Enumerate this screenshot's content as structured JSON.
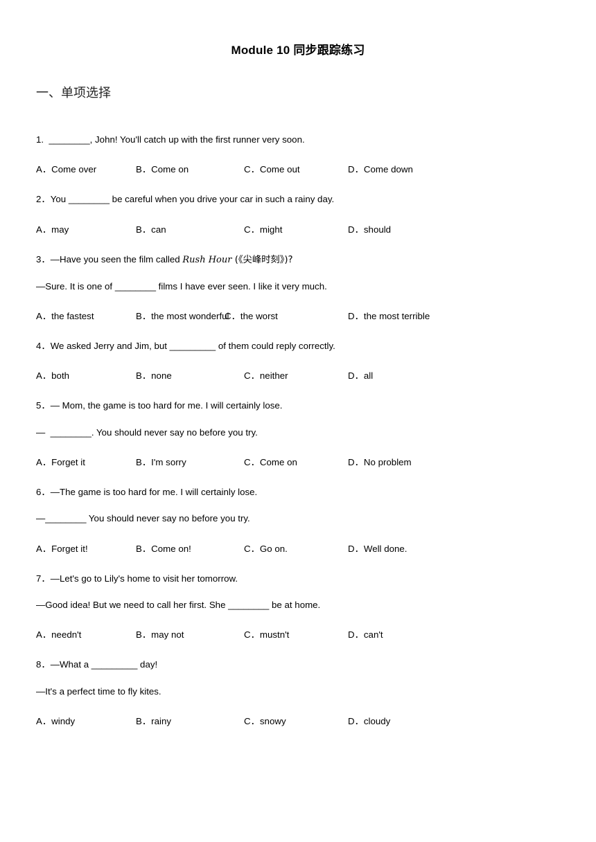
{
  "document": {
    "title": "Module 10 同步跟踪练习",
    "section_heading": "一、单项选择"
  },
  "questions": [
    {
      "lines": [
        "1.  ________, John! You'll catch up with the first runner very soon."
      ],
      "options": {
        "a": "A．Come over",
        "b": "B．Come on",
        "c": "C．Come out",
        "d": "D．Come down"
      }
    },
    {
      "lines": [
        "2．You ________ be careful when you drive your car in such a rainy day."
      ],
      "options": {
        "a": "A．may",
        "b": "B．can",
        "c": "C．might",
        "d": "D．should"
      }
    },
    {
      "lines_part1": "3．—Have you seen the film called ",
      "italic": "Rush Hour",
      "lines_part2": " (《尖峰时刻》)?",
      "line2": "—Sure. It is one of ________ films I have ever seen. I like it very much.",
      "options": {
        "a": "A．the fastest",
        "b": "B．the most wonderful",
        "c": "C．the worst",
        "d": "D．the most terrible"
      }
    },
    {
      "lines": [
        "4．We asked Jerry and Jim, but _________ of them could reply correctly."
      ],
      "options": {
        "a": "A．both",
        "b": "B．none",
        "c": "C．neither",
        "d": "D．all"
      }
    },
    {
      "line1": "5．— Mom, the game is too hard for me. I will certainly lose.",
      "line2": "—  ________. You should never say no before you try.",
      "options": {
        "a": "A．Forget it",
        "b": "B．I'm sorry",
        "c": "C．Come on",
        "d": "D．No problem"
      }
    },
    {
      "line1": "6．—The game is too hard for me. I will certainly lose.",
      "line2": "—________ You should never say no before you try.",
      "options": {
        "a": "A．Forget it!",
        "b": "B．Come on!",
        "c": "C．Go on.",
        "d": "D．Well done."
      }
    },
    {
      "line1": "7．—Let's go to Lily's home to visit her tomorrow.",
      "line2": "—Good idea! But we need to call her first. She ________ be at home.",
      "options": {
        "a": "A．needn't",
        "b": "B．may not",
        "c": "C．mustn't",
        "d": "D．can't"
      }
    },
    {
      "line1": "8．—What a _________ day!",
      "line2": "—It's a perfect time to fly kites.",
      "options": {
        "a": "A．windy",
        "b": "B．rainy",
        "c": "C．snowy",
        "d": "D．cloudy"
      }
    }
  ]
}
